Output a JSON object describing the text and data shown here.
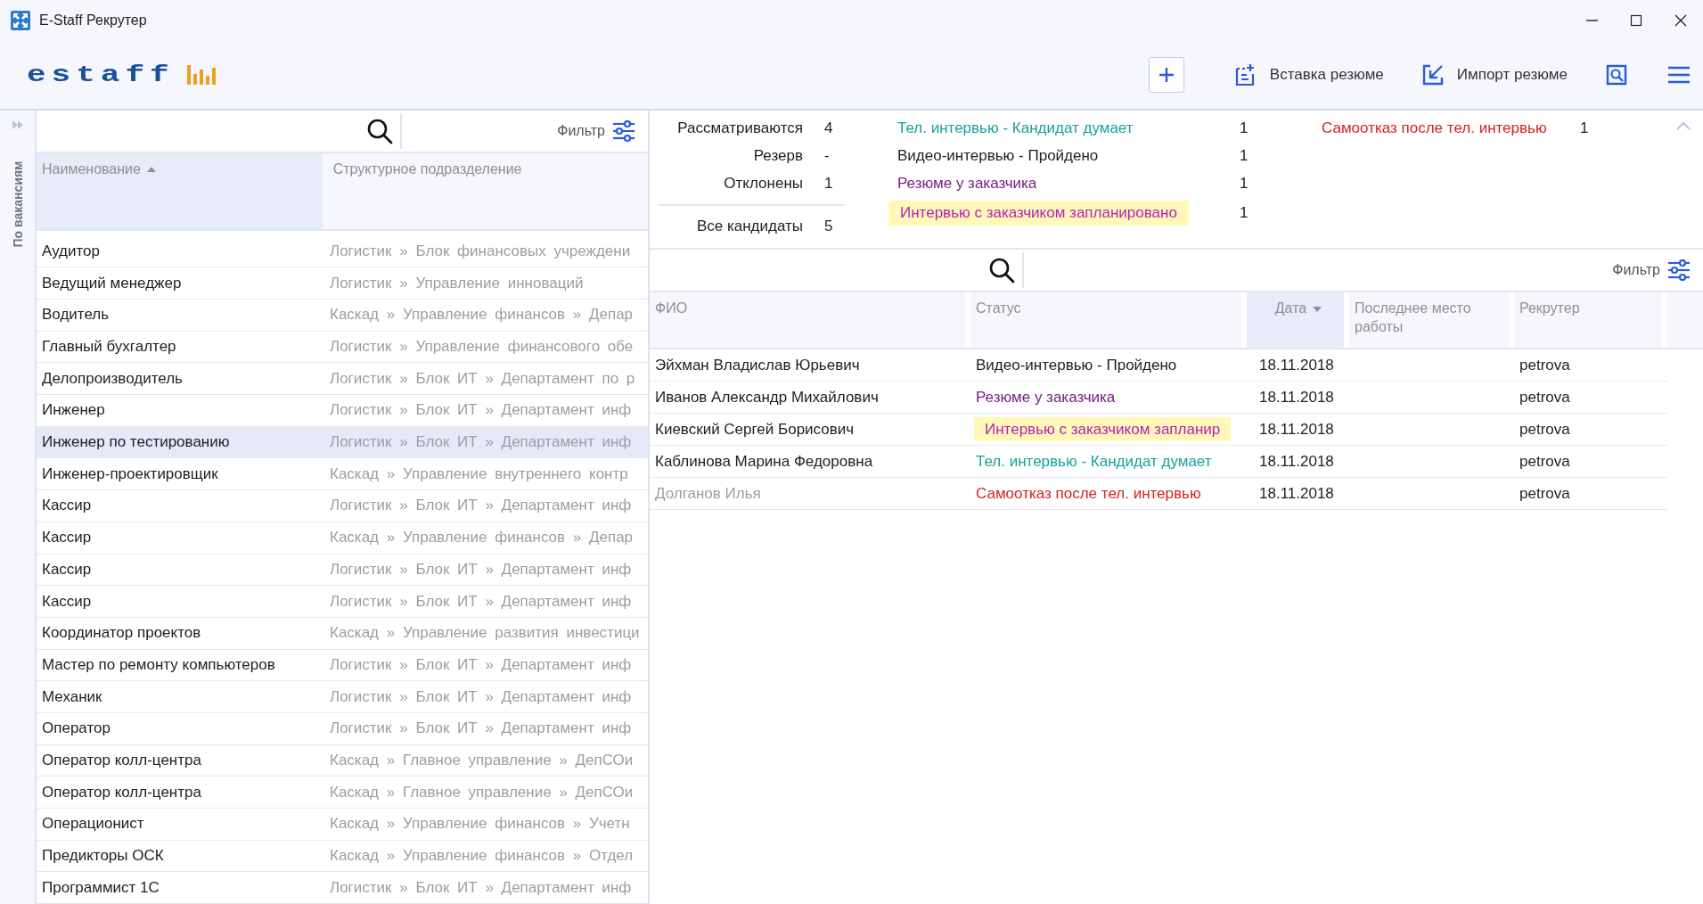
{
  "window": {
    "title": "E-Staff Рекрутер"
  },
  "header": {
    "logo": "estaff",
    "actions": [
      {
        "kind": "add"
      },
      {
        "kind": "paste",
        "label": "Вставка резюме"
      },
      {
        "kind": "import",
        "label": "Импорт резюме"
      },
      {
        "kind": "search"
      },
      {
        "kind": "menu"
      }
    ]
  },
  "sidebar": {
    "label": "По вакансиям"
  },
  "vacancies": {
    "filter": "Фильтр",
    "columns": [
      {
        "label": "Наименование",
        "sorted": true,
        "descending": false
      },
      {
        "label": "Структурное подразделение",
        "sorted": false
      }
    ],
    "rows": [
      {
        "name": "Аудитор",
        "division": "Логистик » Блок финансовых учреждени",
        "selected": false
      },
      {
        "name": "Ведущий менеджер",
        "division": "Логистик » Управление инноваций",
        "selected": false
      },
      {
        "name": "Водитель",
        "division": "Каскад » Управление финансов » Депар",
        "selected": false
      },
      {
        "name": "Главный бухгалтер",
        "division": "Логистик » Управление финансового обе",
        "selected": false
      },
      {
        "name": "Делопроизводитель",
        "division": "Логистик » Блок ИТ » Департамент по р",
        "selected": false
      },
      {
        "name": "Инженер",
        "division": "Логистик » Блок ИТ » Департамент инф",
        "selected": false
      },
      {
        "name": "Инженер по тестированию",
        "division": "Логистик » Блок ИТ » Департамент инф",
        "selected": true
      },
      {
        "name": "Инженер-проектировщик",
        "division": "Каскад » Управление внутреннего контр",
        "selected": false
      },
      {
        "name": "Кассир",
        "division": "Логистик » Блок ИТ » Департамент инф",
        "selected": false
      },
      {
        "name": "Кассир",
        "division": "Каскад » Управление финансов » Депар",
        "selected": false
      },
      {
        "name": "Кассир",
        "division": "Логистик » Блок ИТ » Департамент инф",
        "selected": false
      },
      {
        "name": "Кассир",
        "division": "Логистик » Блок ИТ » Департамент инф",
        "selected": false
      },
      {
        "name": "Координатор проектов",
        "division": "Каскад » Управление развития инвестици",
        "selected": false
      },
      {
        "name": "Мастер по ремонту компьютеров",
        "division": "Логистик » Блок ИТ » Департамент инф",
        "selected": false
      },
      {
        "name": "Механик",
        "division": "Логистик » Блок ИТ » Департамент инф",
        "selected": false
      },
      {
        "name": "Оператор",
        "division": "Логистик » Блок ИТ » Департамент инф",
        "selected": false
      },
      {
        "name": "Оператор колл-центра",
        "division": "Каскад » Главное управление » ДепСОи",
        "selected": false
      },
      {
        "name": "Оператор колл-центра",
        "division": "Каскад » Главное управление » ДепСОи",
        "selected": false
      },
      {
        "name": "Операционист",
        "division": "Каскад » Управление финансов » Учетн",
        "selected": false
      },
      {
        "name": "Предикторы ОСК",
        "division": "Каскад » Управление финансов » Отдел",
        "selected": false
      },
      {
        "name": "Программист 1С",
        "division": "Логистик » Блок ИТ » Департамент инф",
        "selected": false
      }
    ]
  },
  "summary": {
    "groups": [
      {
        "label": "Рассматриваются",
        "count": "4"
      },
      {
        "label": "Резерв",
        "count": "-"
      },
      {
        "label": "Отклонены",
        "count": "1"
      }
    ],
    "total": {
      "label": "Все кандидаты",
      "count": "5"
    },
    "status_columns": [
      [
        {
          "label": "Тел. интервью - Кандидат думает",
          "count": "1",
          "color": "#16a0a0",
          "highlighted": false
        },
        {
          "label": "Видео-интервью - Пройдено",
          "count": "1",
          "color": "#1e1e1e",
          "highlighted": false
        },
        {
          "label": "Резюме у заказчика",
          "count": "1",
          "color": "#7a1f86",
          "highlighted": false
        },
        {
          "label": "Интервью с заказчиком запланировано",
          "count": "1",
          "color": "#b423b4",
          "highlighted": true
        }
      ],
      [
        {
          "label": "Самоотказ после тел. интервью",
          "count": "1",
          "color": "#d42222",
          "highlighted": false
        }
      ]
    ]
  },
  "candidates": {
    "filter": "Фильтр",
    "columns": [
      {
        "label": "ФИО",
        "sorted": false
      },
      {
        "label": "Статус",
        "sorted": false
      },
      {
        "label": "Дата",
        "sorted": true,
        "descending": true
      },
      {
        "label": "Последнее место работы",
        "sorted": false
      },
      {
        "label": "Рекрутер",
        "sorted": false
      }
    ],
    "rows": [
      {
        "name": "Эйхман Владислав Юрьевич",
        "dimmed": false,
        "status": {
          "label": "Видео-интервью - Пройдено",
          "color": "#1e1e1e",
          "highlighted": false
        },
        "date": "18.11.2018",
        "recruiter": "petrova"
      },
      {
        "name": "Иванов Александр Михайлович",
        "dimmed": false,
        "status": {
          "label": "Резюме у заказчика",
          "color": "#7a1f86",
          "highlighted": false
        },
        "date": "18.11.2018",
        "recruiter": "petrova"
      },
      {
        "name": "Киевский Сергей Борисович",
        "dimmed": false,
        "status": {
          "label": "Интервью с заказчиком запланир",
          "color": "#b423b4",
          "highlighted": true
        },
        "date": "18.11.2018",
        "recruiter": "petrova"
      },
      {
        "name": "Каблинова Марина Федоровна",
        "dimmed": false,
        "status": {
          "label": "Тел. интервью - Кандидат думает",
          "color": "#16a0a0",
          "highlighted": false
        },
        "date": "18.11.2018",
        "recruiter": "petrova"
      },
      {
        "name": "Долганов Илья",
        "dimmed": true,
        "status": {
          "label": "Самоотказ после тел. интервью",
          "color": "#d42222",
          "highlighted": false
        },
        "date": "18.11.2018",
        "recruiter": "petrova"
      }
    ]
  }
}
